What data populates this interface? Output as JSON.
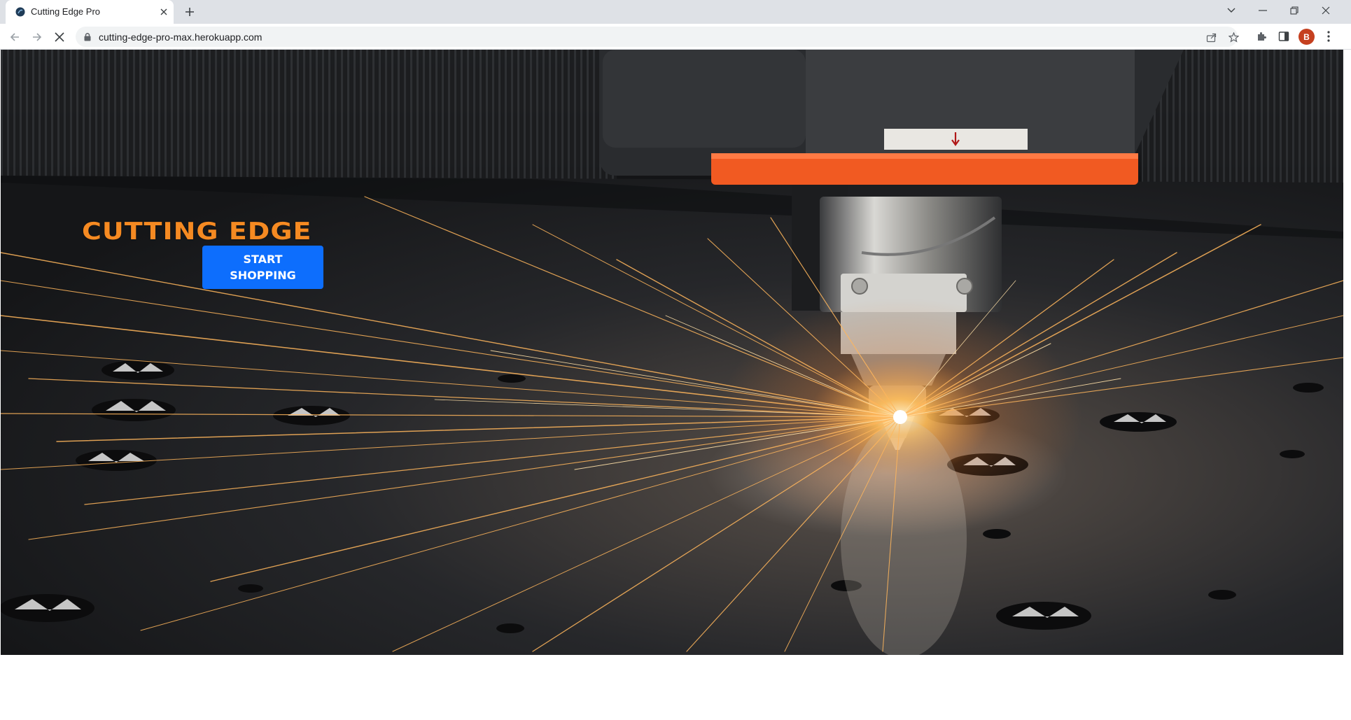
{
  "browser": {
    "tab": {
      "title": "Cutting Edge Pro"
    },
    "address_bar": {
      "url": "cutting-edge-pro-max.herokuapp.com"
    },
    "profile_initial": "B",
    "colors": {
      "avatar": "#c5401f",
      "tab_strip": "#dee1e6",
      "omnibox": "#f1f3f4"
    }
  },
  "page": {
    "brand": "CUTTING EDGE",
    "cta_label": "START SHOPPING",
    "colors": {
      "brand": "#f58a22",
      "cta": "#0d6efd",
      "machine_accent": "#f15a22"
    }
  }
}
